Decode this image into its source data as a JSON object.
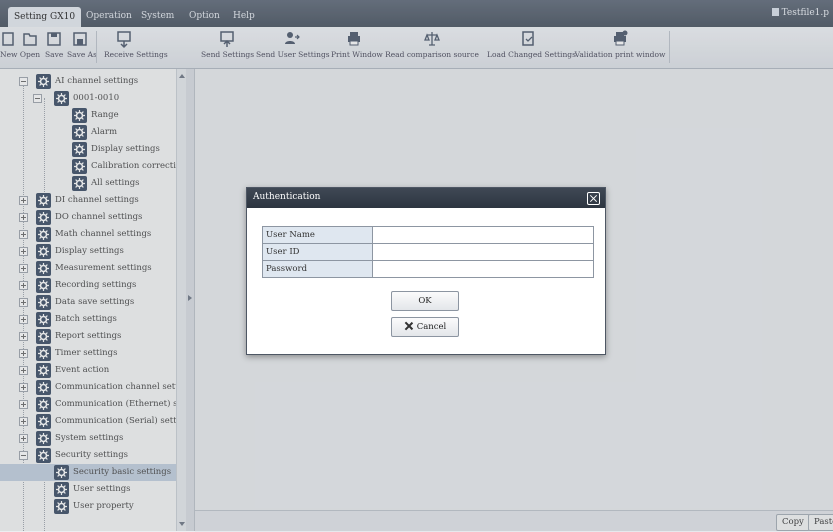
{
  "menubar": {
    "tabs": [
      "Setting GX10",
      "Operation",
      "System",
      "Option",
      "Help"
    ],
    "active_tab": "Setting GX10",
    "file_title": "Testfile1.p"
  },
  "toolbar": {
    "buttons": [
      {
        "label": "New",
        "icon": "new-file-icon"
      },
      {
        "label": "Open",
        "icon": "folder-open-icon"
      },
      {
        "label": "Save",
        "icon": "save-icon"
      },
      {
        "label": "Save As",
        "icon": "save-as-icon"
      },
      {
        "label": "Receive Settings",
        "icon": "receive-icon"
      },
      {
        "label": "Send Settings",
        "icon": "send-icon"
      },
      {
        "label": "Send User Settings",
        "icon": "send-user-icon"
      },
      {
        "label": "Print Window",
        "icon": "printer-icon"
      },
      {
        "label": "Read comparison source",
        "icon": "compare-icon"
      },
      {
        "label": "Load Changed Settings",
        "icon": "load-icon"
      },
      {
        "label": "Validation print window",
        "icon": "validation-print-icon"
      }
    ]
  },
  "tree": {
    "items": [
      {
        "label": "AI channel settings"
      },
      {
        "label": "0001-0010"
      },
      {
        "label": "Range"
      },
      {
        "label": "Alarm"
      },
      {
        "label": "Display settings"
      },
      {
        "label": "Calibration correction"
      },
      {
        "label": "All settings"
      },
      {
        "label": "DI channel settings"
      },
      {
        "label": "DO channel settings"
      },
      {
        "label": "Math channel settings"
      },
      {
        "label": "Display settings"
      },
      {
        "label": "Measurement settings"
      },
      {
        "label": "Recording settings"
      },
      {
        "label": "Data save settings"
      },
      {
        "label": "Batch settings"
      },
      {
        "label": "Report settings"
      },
      {
        "label": "Timer settings"
      },
      {
        "label": "Event action"
      },
      {
        "label": "Communication channel settings"
      },
      {
        "label": "Communication (Ethernet) settings"
      },
      {
        "label": "Communication (Serial) settings"
      },
      {
        "label": "System settings"
      },
      {
        "label": "Security settings"
      },
      {
        "label": "Security basic settings"
      },
      {
        "label": "User settings"
      },
      {
        "label": "User property"
      }
    ],
    "selected": "Security basic settings"
  },
  "statusbar": {
    "copy_label": "Copy",
    "paste_label": "Paste"
  },
  "dialog": {
    "title": "Authentication",
    "fields": [
      {
        "label": "User Name",
        "value": ""
      },
      {
        "label": "User ID",
        "value": ""
      },
      {
        "label": "Password",
        "value": ""
      }
    ],
    "ok_label": "OK",
    "cancel_label": "Cancel"
  },
  "colors": {
    "icon_blue": "#4c5c72",
    "titlebar": "#2d3540",
    "menubar": "#5f6875"
  }
}
